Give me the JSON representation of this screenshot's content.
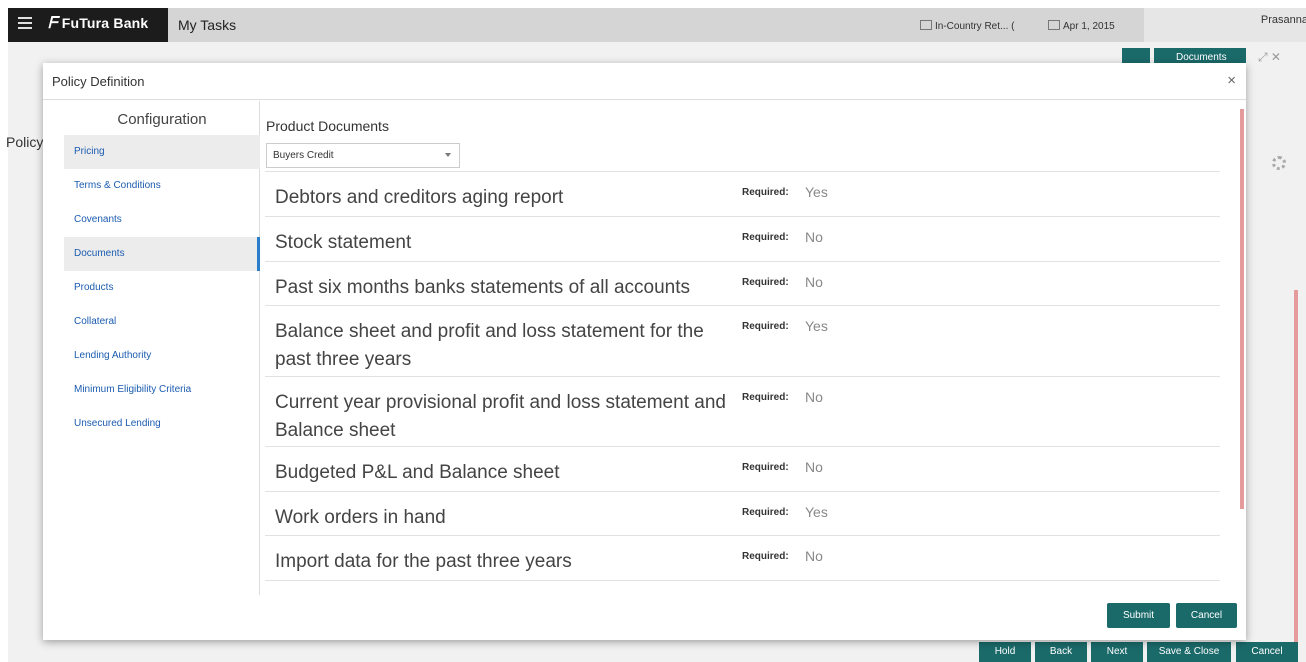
{
  "header": {
    "brand": "FuTura Bank",
    "tab": "My Tasks",
    "branch": "In-Country Ret... (",
    "date": "Apr 1, 2015",
    "user": "Prasanna"
  },
  "background": {
    "documents_button": "Documents",
    "page_title": "Policy",
    "bottom_buttons": [
      "Hold",
      "Back",
      "Next",
      "Save & Close",
      "Cancel"
    ]
  },
  "modal": {
    "title": "Policy Definition",
    "close": "×",
    "sidebar": {
      "title": "Configuration",
      "items": [
        "Pricing",
        "Terms & Conditions",
        "Covenants",
        "Documents",
        "Products",
        "Collateral",
        "Lending Authority",
        "Minimum Eligibility Criteria",
        "Unsecured Lending"
      ]
    },
    "product_documents": {
      "label": "Product Documents",
      "selected_product": "Buyers Credit",
      "required_label": "Required:",
      "rows": [
        {
          "name": "Debtors and creditors aging report",
          "required": "Yes"
        },
        {
          "name": "Stock statement",
          "required": "No"
        },
        {
          "name": "Past six months banks statements of all accounts",
          "required": "No"
        },
        {
          "name": "Balance sheet and profit and loss statement for the past three years",
          "required": "Yes"
        },
        {
          "name": "Current year provisional profit and loss statement and Balance sheet",
          "required": "No"
        },
        {
          "name": "Budgeted P&L and Balance sheet",
          "required": "No"
        },
        {
          "name": "Work orders in hand",
          "required": "Yes"
        },
        {
          "name": "Import data for the past three years",
          "required": "No"
        }
      ]
    },
    "buttons": {
      "submit": "Submit",
      "cancel": "Cancel"
    }
  },
  "colors": {
    "primary": "#1b6a6a",
    "link": "#1a5bb0",
    "topbar": "#1c1c1c"
  }
}
